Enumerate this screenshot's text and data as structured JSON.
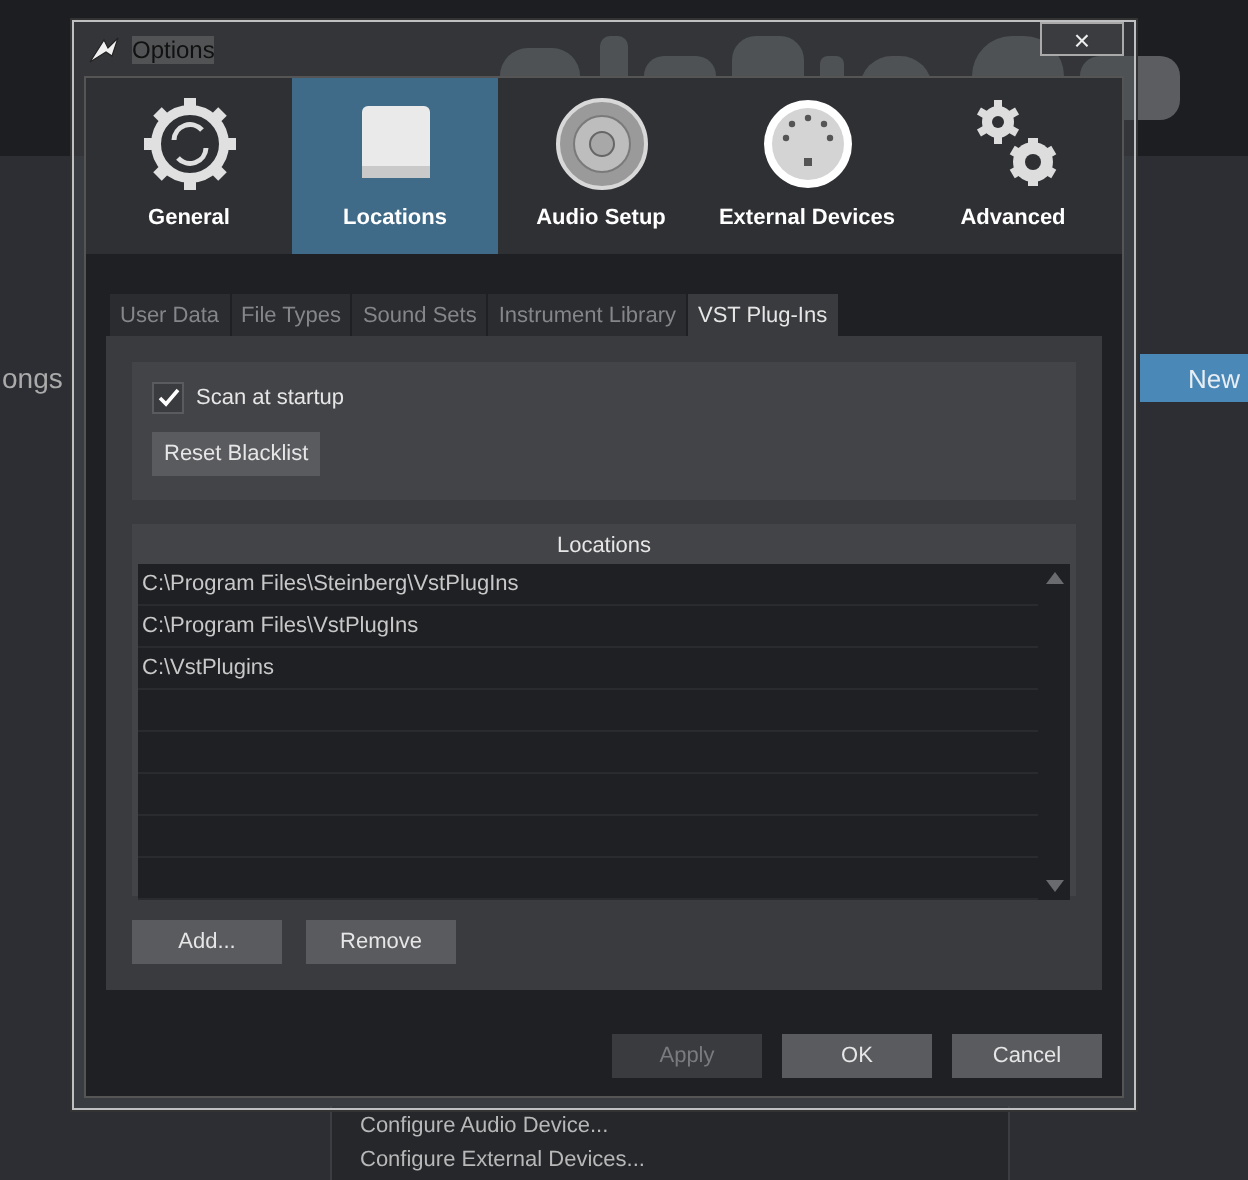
{
  "background": {
    "left_label": "ongs",
    "new_button": "New",
    "menu_items": [
      "Configure Audio Device...",
      "Configure External Devices..."
    ]
  },
  "window": {
    "title": "Options",
    "close": "×"
  },
  "categories": [
    {
      "label": "General",
      "kind": "general",
      "selected": false
    },
    {
      "label": "Locations",
      "kind": "locations",
      "selected": true
    },
    {
      "label": "Audio Setup",
      "kind": "audio",
      "selected": false
    },
    {
      "label": "External Devices",
      "kind": "external",
      "selected": false
    },
    {
      "label": "Advanced",
      "kind": "advanced",
      "selected": false
    }
  ],
  "tabs": [
    {
      "label": "User Data",
      "selected": false
    },
    {
      "label": "File Types",
      "selected": false
    },
    {
      "label": "Sound Sets",
      "selected": false
    },
    {
      "label": "Instrument Library",
      "selected": false
    },
    {
      "label": "VST Plug-Ins",
      "selected": true
    }
  ],
  "scan_at_startup": {
    "label": "Scan at startup",
    "checked": true
  },
  "reset_button": "Reset Blacklist",
  "locations": {
    "title": "Locations",
    "rows": [
      "C:\\Program Files\\Steinberg\\VstPlugIns",
      "C:\\Program Files\\VstPlugIns",
      "C:\\VstPlugins"
    ]
  },
  "list_buttons": [
    "Add...",
    "Remove"
  ],
  "dialog_buttons": [
    {
      "label": "Apply",
      "disabled": true
    },
    {
      "label": "OK",
      "disabled": false
    },
    {
      "label": "Cancel",
      "disabled": false
    }
  ]
}
